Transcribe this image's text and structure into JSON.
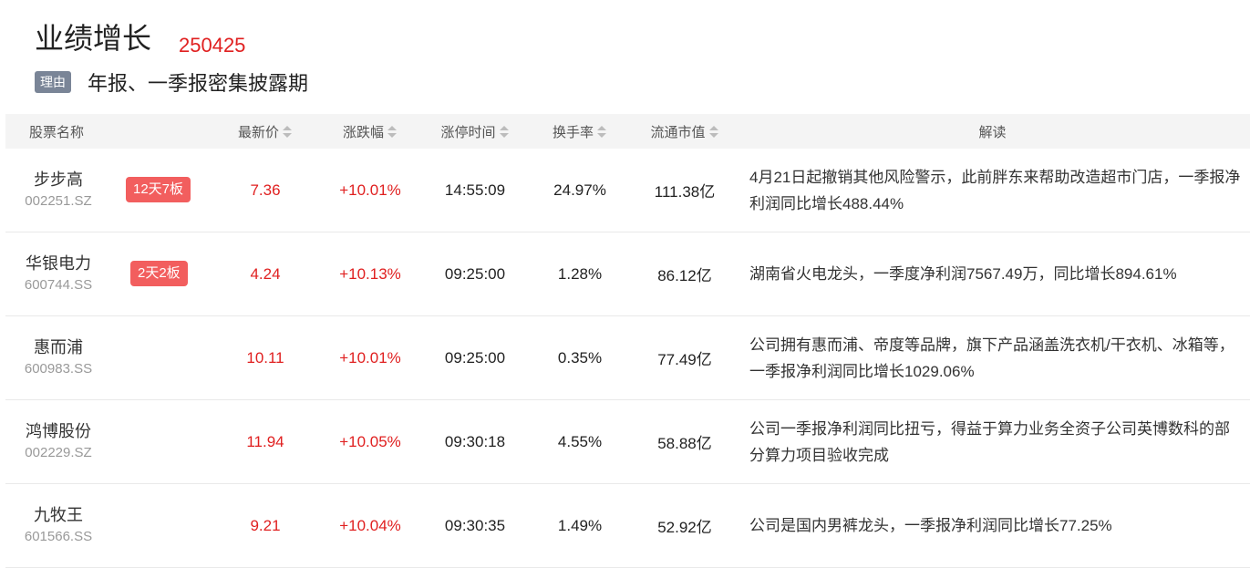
{
  "header": {
    "title": "业绩增长",
    "date": "250425",
    "reason_tag": "理由",
    "reason_text": "年报、一季报密集披露期"
  },
  "columns": {
    "name": "股票名称",
    "price": "最新价",
    "change": "涨跌幅",
    "limit_time": "涨停时间",
    "turnover": "换手率",
    "market_cap": "流通市值",
    "note": "解读"
  },
  "rows": [
    {
      "name": "步步高",
      "code": "002251.SZ",
      "streak": "12天7板",
      "price": "7.36",
      "change": "+10.01%",
      "limit_time": "14:55:09",
      "turnover": "24.97%",
      "market_cap": "111.38亿",
      "note": "4月21日起撤销其他风险警示，此前胖东来帮助改造超市门店，一季报净利润同比增长488.44%"
    },
    {
      "name": "华银电力",
      "code": "600744.SS",
      "streak": "2天2板",
      "price": "4.24",
      "change": "+10.13%",
      "limit_time": "09:25:00",
      "turnover": "1.28%",
      "market_cap": "86.12亿",
      "note": "湖南省火电龙头，一季度净利润7567.49万，同比增长894.61%"
    },
    {
      "name": "惠而浦",
      "code": "600983.SS",
      "streak": "",
      "price": "10.11",
      "change": "+10.01%",
      "limit_time": "09:25:00",
      "turnover": "0.35%",
      "market_cap": "77.49亿",
      "note": "公司拥有惠而浦、帝度等品牌，旗下产品涵盖洗衣机/干衣机、冰箱等，一季报净利润同比增长1029.06%"
    },
    {
      "name": "鸿博股份",
      "code": "002229.SZ",
      "streak": "",
      "price": "11.94",
      "change": "+10.05%",
      "limit_time": "09:30:18",
      "turnover": "4.55%",
      "market_cap": "58.88亿",
      "note": "公司一季报净利润同比扭亏，得益于算力业务全资子公司英博数科的部分算力项目验收完成"
    },
    {
      "name": "九牧王",
      "code": "601566.SS",
      "streak": "",
      "price": "9.21",
      "change": "+10.04%",
      "limit_time": "09:30:35",
      "turnover": "1.49%",
      "market_cap": "52.92亿",
      "note": "公司是国内男裤龙头，一季报净利润同比增长77.25%"
    }
  ]
}
